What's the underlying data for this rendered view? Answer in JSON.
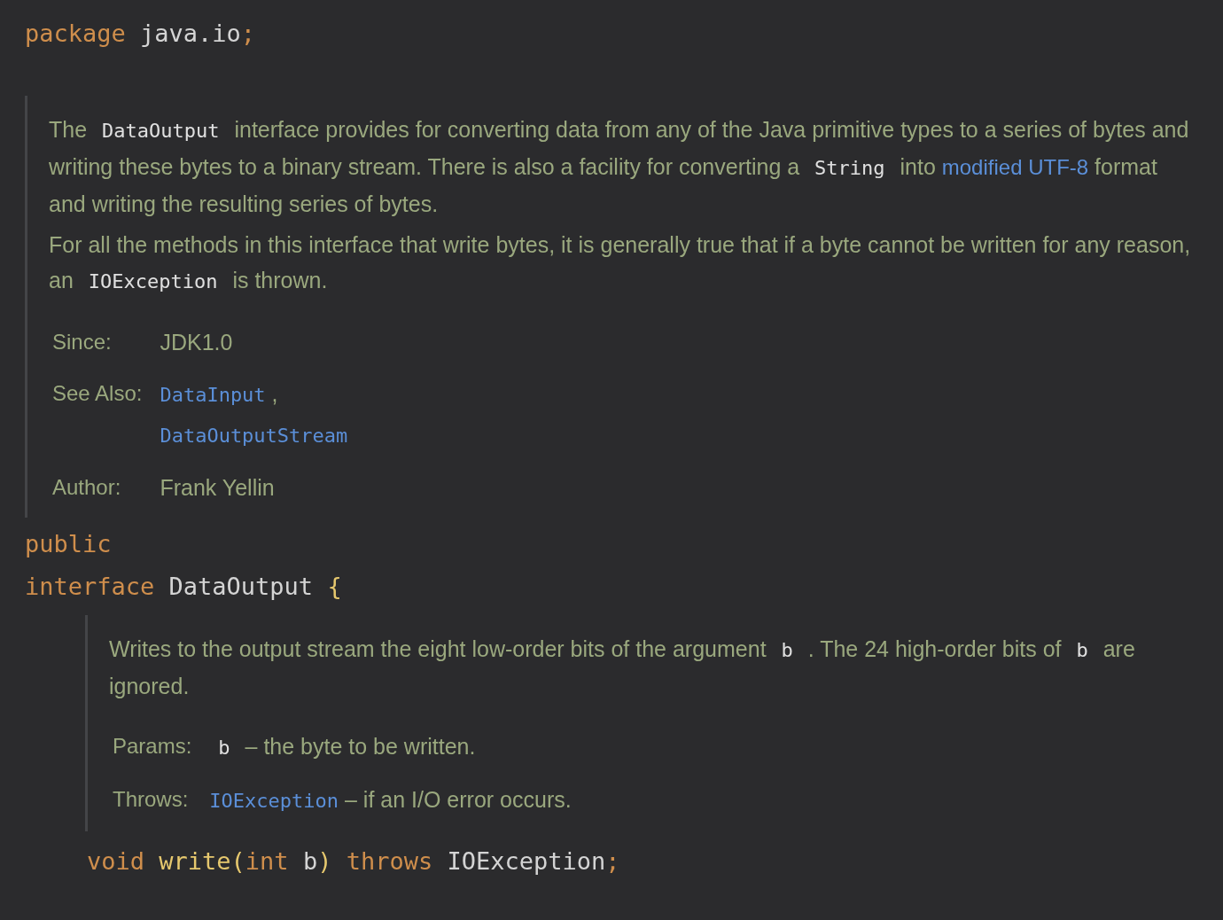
{
  "package_line": [
    {
      "kind": "keyword",
      "text": "package"
    },
    {
      "kind": "plain",
      "text": " java.io"
    },
    {
      "kind": "punct",
      "text": ";"
    }
  ],
  "class_doc": {
    "paragraphs": [
      [
        {
          "kind": "text",
          "text": "The "
        },
        {
          "kind": "code",
          "text": "DataOutput"
        },
        {
          "kind": "text",
          "text": " interface provides for converting data from any of the Java primitive types to a series of bytes and writing these bytes to a binary stream. There is also a facility for converting a "
        },
        {
          "kind": "code",
          "text": "String"
        },
        {
          "kind": "text",
          "text": " into "
        },
        {
          "kind": "link",
          "text": "modified UTF-8"
        },
        {
          "kind": "text",
          "text": " format and writing the resulting series of bytes."
        }
      ],
      [
        {
          "kind": "text",
          "text": "For all the methods in this interface that write bytes, it is generally true that if a byte cannot be written for any reason, an "
        },
        {
          "kind": "code",
          "text": "IOException"
        },
        {
          "kind": "text",
          "text": " is thrown."
        }
      ]
    ],
    "tags": [
      {
        "label": "Since:",
        "lines": [
          [
            {
              "kind": "text",
              "text": "JDK1.0"
            }
          ]
        ]
      },
      {
        "label": "See Also:",
        "lines": [
          [
            {
              "kind": "code_link",
              "text": "DataInput"
            },
            {
              "kind": "text",
              "text": " ,"
            }
          ],
          [
            {
              "kind": "code_link",
              "text": "DataOutputStream"
            }
          ]
        ]
      },
      {
        "label": "Author:",
        "lines": [
          [
            {
              "kind": "text",
              "text": "Frank Yellin"
            }
          ]
        ]
      }
    ]
  },
  "declaration": [
    [
      {
        "kind": "keyword",
        "text": "public"
      }
    ],
    [
      {
        "kind": "keyword",
        "text": "interface"
      },
      {
        "kind": "plain",
        "text": " DataOutput "
      },
      {
        "kind": "brace",
        "text": "{"
      }
    ]
  ],
  "method_doc": {
    "paragraphs": [
      [
        {
          "kind": "text",
          "text": "Writes to the output stream the eight low-order bits of the argument "
        },
        {
          "kind": "code",
          "text": "b"
        },
        {
          "kind": "text",
          "text": " . The 24 high-order bits of "
        },
        {
          "kind": "code",
          "text": "b"
        },
        {
          "kind": "text",
          "text": " are ignored."
        }
      ]
    ],
    "tags": [
      {
        "label": "Params:",
        "lines": [
          [
            {
              "kind": "code",
              "text": "b"
            },
            {
              "kind": "text",
              "text": " – the byte to be written."
            }
          ]
        ]
      },
      {
        "label": "Throws:",
        "lines": [
          [
            {
              "kind": "code_link",
              "text": "IOException"
            },
            {
              "kind": "text",
              "text": " – if an I/O error occurs."
            }
          ]
        ]
      }
    ]
  },
  "method_signature": [
    {
      "kind": "keyword",
      "text": "void"
    },
    {
      "kind": "method",
      "text": " write"
    },
    {
      "kind": "brace",
      "text": "("
    },
    {
      "kind": "keyword",
      "text": "int"
    },
    {
      "kind": "plain",
      "text": " b"
    },
    {
      "kind": "brace",
      "text": ")"
    },
    {
      "kind": "keyword",
      "text": " throws"
    },
    {
      "kind": "plain",
      "text": " IOException"
    },
    {
      "kind": "punct",
      "text": ";"
    }
  ]
}
